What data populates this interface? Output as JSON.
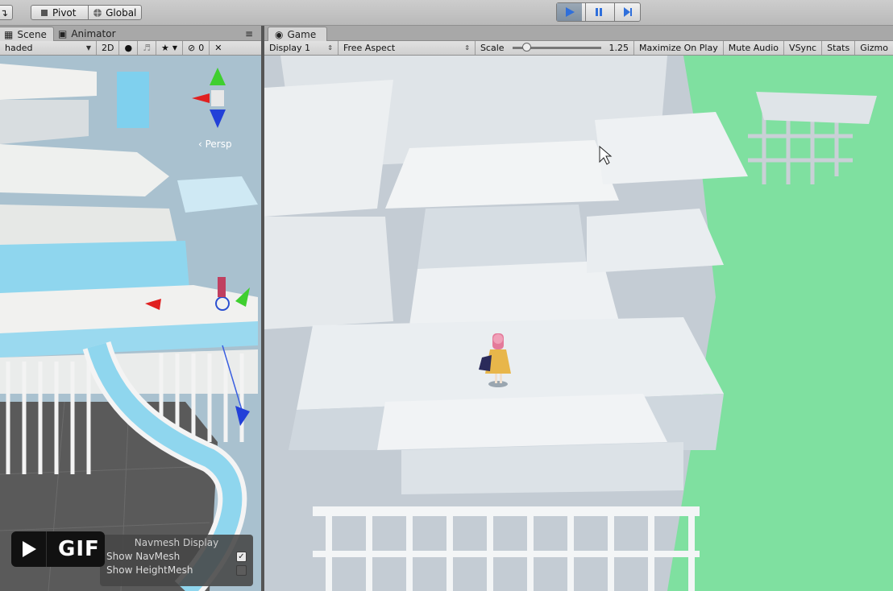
{
  "toolbar": {
    "pivot_label": "Pivot",
    "global_label": "Global"
  },
  "scene_tabs": {
    "scene": "Scene",
    "animator": "Animator"
  },
  "scene_controls": {
    "shading_mode": "haded",
    "mode_2d": "2D",
    "hidden_count": "0"
  },
  "scene": {
    "persp_label": "‹ Persp"
  },
  "game_tab": {
    "label": "Game"
  },
  "game_controls": {
    "display": "Display 1",
    "aspect": "Free Aspect",
    "scale_label": "Scale",
    "scale_value": "1.25",
    "maximize_on_play": "Maximize On Play",
    "mute_audio": "Mute Audio",
    "vsync": "VSync",
    "stats": "Stats",
    "gizmos": "Gizmo"
  },
  "navmesh_display": {
    "title": "Navmesh Display",
    "show_navmesh": "Show NavMesh",
    "show_navmesh_checked": true,
    "show_heightmesh": "Show HeightMesh",
    "show_heightmesh_checked": false
  },
  "gif_badge": {
    "label": "GIF"
  },
  "colors": {
    "play_active": "#2f6fdb",
    "ground_green": "#7fe0a0",
    "navmesh_blue": "#8fd6ee"
  }
}
